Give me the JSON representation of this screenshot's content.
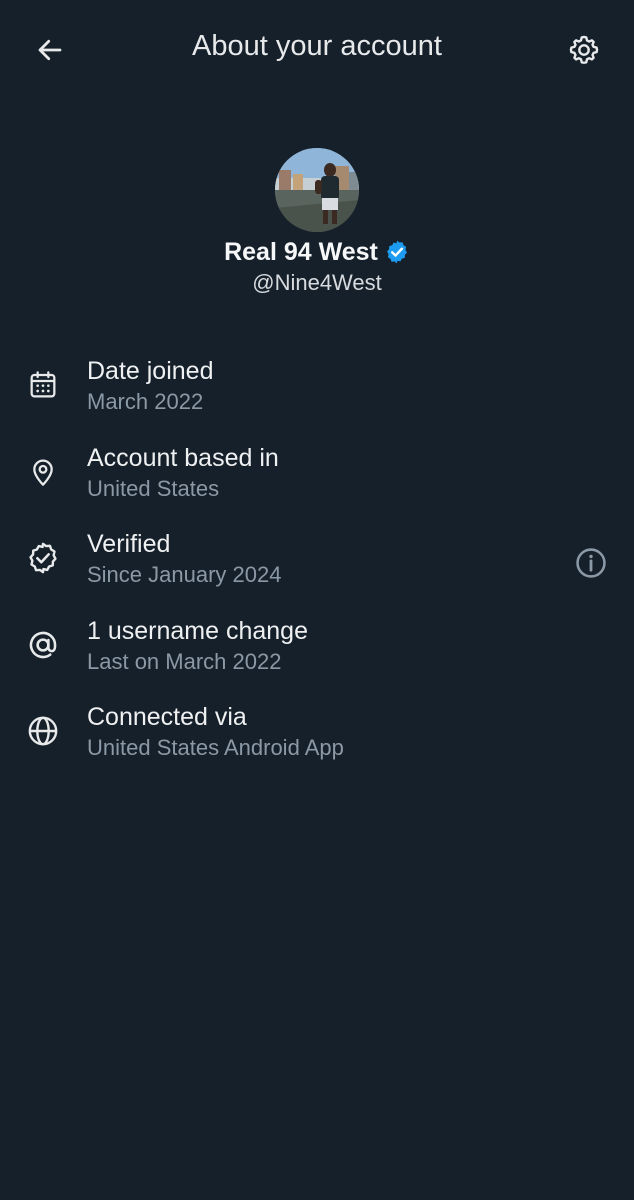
{
  "header": {
    "title": "About your account",
    "back_icon": "arrow-left-icon",
    "settings_icon": "gear-icon"
  },
  "profile": {
    "display_name": "Real 94 West",
    "handle": "@Nine4West",
    "verified_badge_color": "#1d9bf0"
  },
  "info": {
    "items": [
      {
        "icon": "calendar-icon",
        "label": "Date joined",
        "value": "March 2022"
      },
      {
        "icon": "location-pin-icon",
        "label": "Account based in",
        "value": "United States"
      },
      {
        "icon": "verified-badge-icon",
        "label": "Verified",
        "value": "Since January 2024",
        "has_info_button": true
      },
      {
        "icon": "at-sign-icon",
        "label": "1 username change",
        "value": "Last on March 2022"
      },
      {
        "icon": "globe-icon",
        "label": "Connected via",
        "value": "United States Android App"
      }
    ]
  },
  "colors": {
    "background": "#16202a",
    "primary_text": "#e7e9ea",
    "secondary_text": "#8b98a5",
    "accent": "#1d9bf0"
  }
}
